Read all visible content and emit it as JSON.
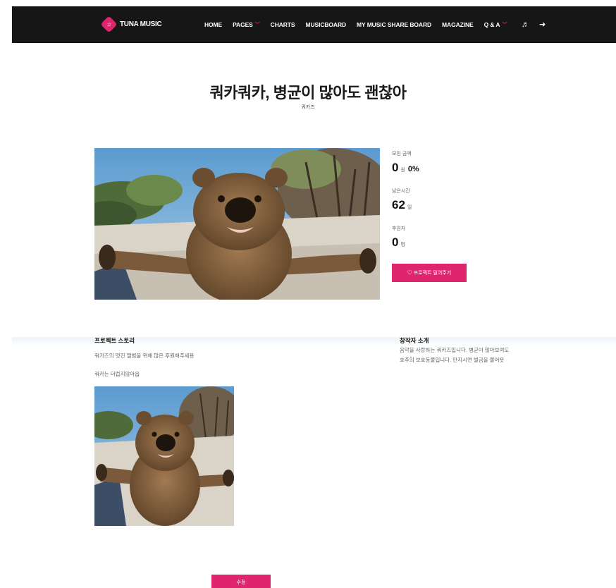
{
  "nav": {
    "logo_text": "TUNA MUSIC",
    "logo_glyph": "♫",
    "items": [
      {
        "label": "HOME",
        "has_caret": false
      },
      {
        "label": "PAGES",
        "has_caret": true
      },
      {
        "label": "CHARTS",
        "has_caret": false
      },
      {
        "label": "MUSICBOARD",
        "has_caret": false
      },
      {
        "label": "MY MUSIC SHARE BOARD",
        "has_caret": false
      },
      {
        "label": "MAGAZINE",
        "has_caret": false
      },
      {
        "label": "Q & A",
        "has_caret": true
      }
    ],
    "caret_glyph": "﹀",
    "icons": [
      "music-note-icon",
      "sign-in-icon"
    ],
    "icon_glyphs": [
      "♬",
      "➜"
    ]
  },
  "project": {
    "title": "쿼카쿼카, 병균이 많아도 괜찮아",
    "creator_name": "쿼카즈"
  },
  "stats": {
    "raised_label": "모인 금액",
    "raised_value": "0",
    "raised_unit": "원",
    "raised_percent": "0%",
    "remaining_label": "남은시간",
    "remaining_value": "62",
    "remaining_unit": "일",
    "backers_label": "후원자",
    "backers_value": "0",
    "backers_unit": "명"
  },
  "fund_button_label": "♡ 프로젝트 밀어주기",
  "story": {
    "heading": "프로젝트 스토리",
    "line1": "쿼카즈의 멋진 앨범을 위해 많은 후원해주세용",
    "line2": "쿼카는 더럽지않아욥"
  },
  "creator_intro": {
    "heading": "창작자 소개",
    "line1": "음악을 사랑하는 쿼카즈입니다. 병균이 많아보여도",
    "line2": "호주의 보호동물입니다. 만지시면 벌금을 물어욧"
  },
  "edit_button_label": "수정",
  "colors": {
    "accent": "#e0256f",
    "navbar_bg": "#161616"
  }
}
